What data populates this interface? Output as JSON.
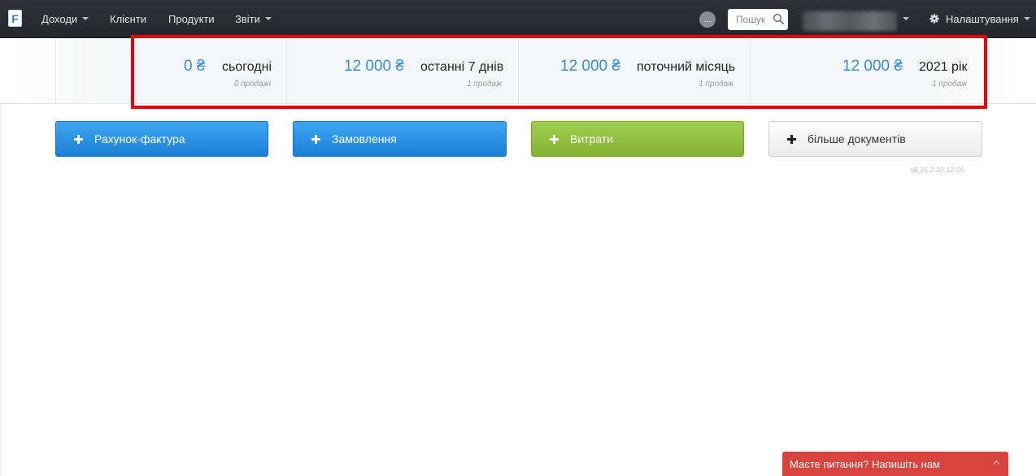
{
  "nav": {
    "logo_letter": "F",
    "items": [
      {
        "label": "Доходи",
        "has_caret": true
      },
      {
        "label": "Клієнти",
        "has_caret": false
      },
      {
        "label": "Продукти",
        "has_caret": false
      },
      {
        "label": "Звіти",
        "has_caret": true
      }
    ],
    "status_badge": "...",
    "search_placeholder": "Пошук",
    "settings_label": "Налаштування"
  },
  "stats": [
    {
      "amount": "0 ₴",
      "period": "сьогодні",
      "count": "0 продажі"
    },
    {
      "amount": "12 000 ₴",
      "period": "останні 7 днів",
      "count": "1 продаж"
    },
    {
      "amount": "12 000 ₴",
      "period": "поточний місяць",
      "count": "1 продаж"
    },
    {
      "amount": "12 000 ₴",
      "period": "2021 рік",
      "count": "1 продаж"
    }
  ],
  "actions": [
    {
      "label": "Рахунок-фактура",
      "style": "blue"
    },
    {
      "label": "Замовлення",
      "style": "blue"
    },
    {
      "label": "Витрати",
      "style": "green"
    },
    {
      "label": "більше документів",
      "style": "grey"
    }
  ],
  "version": "v8.26.2.20.12.00",
  "chat": {
    "label": "Маєте питання? Напишіть нам"
  },
  "colors": {
    "navbar": "#2a2d32",
    "amount": "#3a8ed4",
    "highlight": "#e5000b",
    "blue_button": "#2a8fe0",
    "green_button": "#8fc13f",
    "chat": "#d9433e"
  }
}
